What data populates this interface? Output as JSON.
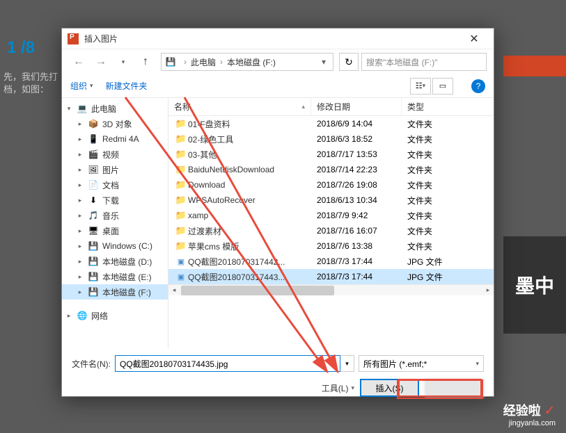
{
  "bg": {
    "counter": "1 /8",
    "text1": "先，我们先打",
    "text2": "档，如图：",
    "rightImgText": "墨中"
  },
  "dialog": {
    "title": "插入图片",
    "breadcrumb": {
      "root": "此电脑",
      "path": "本地磁盘 (F:)"
    },
    "search_placeholder": "搜索\"本地磁盘 (F:)\"",
    "toolbar": {
      "organize": "组织",
      "newfolder": "新建文件夹"
    },
    "columns": {
      "name": "名称",
      "date": "修改日期",
      "type": "类型"
    },
    "tree": [
      {
        "label": "此电脑",
        "icon": "💻",
        "chevron": "▾",
        "indent": 0
      },
      {
        "label": "3D 对象",
        "icon": "📦",
        "chevron": "▸",
        "indent": 1
      },
      {
        "label": "Redmi 4A",
        "icon": "📱",
        "chevron": "▸",
        "indent": 1
      },
      {
        "label": "视频",
        "icon": "🎬",
        "chevron": "▸",
        "indent": 1
      },
      {
        "label": "图片",
        "icon": "🖼",
        "chevron": "▸",
        "indent": 1
      },
      {
        "label": "文档",
        "icon": "📄",
        "chevron": "▸",
        "indent": 1
      },
      {
        "label": "下载",
        "icon": "⬇",
        "chevron": "▸",
        "indent": 1
      },
      {
        "label": "音乐",
        "icon": "🎵",
        "chevron": "▸",
        "indent": 1
      },
      {
        "label": "桌面",
        "icon": "🖥",
        "chevron": "▸",
        "indent": 1
      },
      {
        "label": "Windows (C:)",
        "icon": "💾",
        "chevron": "▸",
        "indent": 1
      },
      {
        "label": "本地磁盘 (D:)",
        "icon": "💾",
        "chevron": "▸",
        "indent": 1
      },
      {
        "label": "本地磁盘 (E:)",
        "icon": "💾",
        "chevron": "▸",
        "indent": 1
      },
      {
        "label": "本地磁盘 (F:)",
        "icon": "💾",
        "chevron": "▸",
        "indent": 1,
        "selected": true
      },
      {
        "label": "网络",
        "icon": "🌐",
        "chevron": "▸",
        "indent": 0
      }
    ],
    "files": [
      {
        "name": "01-F盘资料",
        "date": "2018/6/9 14:04",
        "type": "文件夹",
        "kind": "folder"
      },
      {
        "name": "02-绿色工具",
        "date": "2018/6/3 18:52",
        "type": "文件夹",
        "kind": "folder"
      },
      {
        "name": "03-其他",
        "date": "2018/7/17 13:53",
        "type": "文件夹",
        "kind": "folder"
      },
      {
        "name": "BaiduNetdiskDownload",
        "date": "2018/7/14 22:23",
        "type": "文件夹",
        "kind": "folder"
      },
      {
        "name": "Download",
        "date": "2018/7/26 19:08",
        "type": "文件夹",
        "kind": "folder"
      },
      {
        "name": "WPSAutoRecover",
        "date": "2018/6/13 10:34",
        "type": "文件夹",
        "kind": "folder"
      },
      {
        "name": "xamp",
        "date": "2018/7/9 9:42",
        "type": "文件夹",
        "kind": "folder"
      },
      {
        "name": "过渡素材",
        "date": "2018/7/16 16:07",
        "type": "文件夹",
        "kind": "folder"
      },
      {
        "name": "苹果cms 模版",
        "date": "2018/7/6 13:38",
        "type": "文件夹",
        "kind": "folder"
      },
      {
        "name": "QQ截图2018070317442...",
        "date": "2018/7/3 17:44",
        "type": "JPG 文件",
        "kind": "image"
      },
      {
        "name": "QQ截图2018070317443...",
        "date": "2018/7/3 17:44",
        "type": "JPG 文件",
        "kind": "image",
        "selected": true
      }
    ],
    "filename_label": "文件名(N):",
    "filename_value": "QQ截图20180703174435.jpg",
    "filetype_value": "所有图片 (*.emf;*",
    "tools_label": "工具(L)",
    "insert_btn": "插入(S)",
    "cancel_btn": ""
  },
  "watermark": {
    "main": "经验啦",
    "sub": "jingyanla.com"
  }
}
